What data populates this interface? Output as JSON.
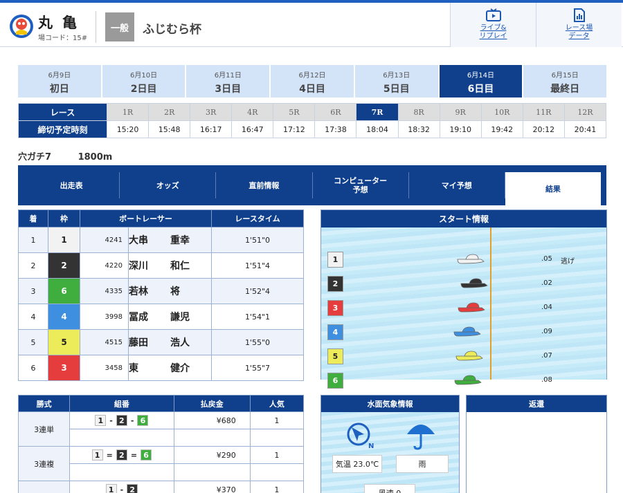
{
  "header": {
    "venue_name": "丸亀",
    "venue_code": "場コード：15#",
    "grade": "一般",
    "race_title": "ふじむら杯",
    "live_btn": [
      "ライブ&",
      "リプレイ"
    ],
    "data_btn": [
      "レース場",
      "データ"
    ]
  },
  "days": [
    {
      "date": "6月9日",
      "label": "初日"
    },
    {
      "date": "6月10日",
      "label": "2日目"
    },
    {
      "date": "6月11日",
      "label": "3日目"
    },
    {
      "date": "6月12日",
      "label": "4日目"
    },
    {
      "date": "6月13日",
      "label": "5日目"
    },
    {
      "date": "6月14日",
      "label": "6日目",
      "active": true
    },
    {
      "date": "6月15日",
      "label": "最終日"
    }
  ],
  "races": {
    "row_label": "レース",
    "time_label": "締切予定時刻",
    "numbers": [
      "1R",
      "2R",
      "3R",
      "4R",
      "5R",
      "6R",
      "7R",
      "8R",
      "9R",
      "10R",
      "11R",
      "12R"
    ],
    "times": [
      "15:20",
      "15:48",
      "16:17",
      "16:47",
      "17:12",
      "17:38",
      "18:04",
      "18:32",
      "19:10",
      "19:42",
      "20:12",
      "20:41"
    ],
    "active_index": 6
  },
  "race_info": {
    "name": "穴ガチ7",
    "distance": "1800m"
  },
  "nav": [
    "出走表",
    "オッズ",
    "直前情報",
    "コンピューター\n予想",
    "マイ予想",
    "結果"
  ],
  "result": {
    "headers": [
      "着",
      "枠",
      "ボートレーサー",
      "レースタイム"
    ],
    "rows": [
      {
        "place": "1",
        "frame": "1",
        "reg": "4241",
        "last": "大串",
        "first": "重幸",
        "time": "1'51\"0"
      },
      {
        "place": "2",
        "frame": "2",
        "reg": "4220",
        "last": "深川",
        "first": "和仁",
        "time": "1'51\"4"
      },
      {
        "place": "3",
        "frame": "6",
        "reg": "4335",
        "last": "若林",
        "first": "将",
        "time": "1'52\"4"
      },
      {
        "place": "4",
        "frame": "4",
        "reg": "3998",
        "last": "冨成",
        "first": "謙児",
        "time": "1'54\"1"
      },
      {
        "place": "5",
        "frame": "5",
        "reg": "4515",
        "last": "藤田",
        "first": "浩人",
        "time": "1'55\"0"
      },
      {
        "place": "6",
        "frame": "3",
        "reg": "3458",
        "last": "東",
        "first": "健介",
        "time": "1'55\"7"
      }
    ]
  },
  "start_info": {
    "title": "スタート情報",
    "rows": [
      {
        "course": "1",
        "st": ".05",
        "note": "逃げ",
        "color": "#f2f2f2"
      },
      {
        "course": "2",
        "st": ".02",
        "note": "",
        "color": "#333333"
      },
      {
        "course": "3",
        "st": ".04",
        "note": "",
        "color": "#e53d3d"
      },
      {
        "course": "4",
        "st": ".09",
        "note": "",
        "color": "#3f8fe0"
      },
      {
        "course": "5",
        "st": ".07",
        "note": "",
        "color": "#ecec5a"
      },
      {
        "course": "6",
        "st": ".08",
        "note": "",
        "color": "#3fae3f"
      }
    ]
  },
  "payout": {
    "headers": [
      "勝式",
      "組番",
      "払戻金",
      "人気"
    ],
    "rows": [
      {
        "kind": "3連単",
        "combo": [
          "1",
          "-",
          "2",
          "-",
          "6"
        ],
        "amount": "¥680",
        "pop": "1"
      },
      {
        "kind": "3連複",
        "combo": [
          "1",
          "=",
          "2",
          "=",
          "6"
        ],
        "amount": "¥290",
        "pop": "1"
      },
      {
        "kind": "",
        "combo": [
          "1",
          "-",
          "2"
        ],
        "amount": "¥370",
        "pop": "1"
      }
    ]
  },
  "weather": {
    "title": "水面気象情報",
    "temp": "気温 23.0℃",
    "condition": "雨",
    "wind_dir": "N",
    "next_label": "風速 0"
  },
  "refund": {
    "title": "返還"
  }
}
